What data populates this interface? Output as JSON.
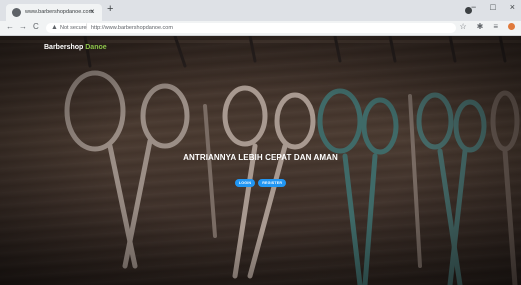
{
  "browser": {
    "tab_title": "www.barbershopdanoe.com",
    "tab_close": "×",
    "new_tab": "+",
    "window_controls": [
      "−",
      "□",
      "×"
    ],
    "nav": {
      "back": "←",
      "forward": "→",
      "reload": "C"
    },
    "omnibox": {
      "security_label": "Not secure",
      "url": "http://www.barbershopdanoe.com"
    },
    "toolbar_icons": [
      "star-icon",
      "extension-icon",
      "menu-icon",
      "profile-icon"
    ]
  },
  "page": {
    "brand": {
      "text": "Barbershop",
      "accent": "Danoe"
    },
    "hero_title": "ANTRIANNYA LEBIH CEPAT DAN AMAN",
    "buttons": {
      "login": "LOGIN",
      "register": "REGISTER"
    },
    "colors": {
      "accent_brand": "#8bc34a",
      "button": "#2196f3"
    }
  }
}
